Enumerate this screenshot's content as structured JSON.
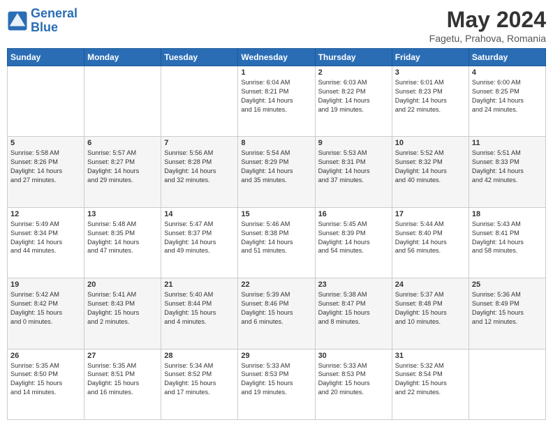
{
  "logo": {
    "line1": "General",
    "line2": "Blue"
  },
  "title": "May 2024",
  "subtitle": "Fagetu, Prahova, Romania",
  "weekdays": [
    "Sunday",
    "Monday",
    "Tuesday",
    "Wednesday",
    "Thursday",
    "Friday",
    "Saturday"
  ],
  "weeks": [
    [
      {
        "day": "",
        "info": ""
      },
      {
        "day": "",
        "info": ""
      },
      {
        "day": "",
        "info": ""
      },
      {
        "day": "1",
        "info": "Sunrise: 6:04 AM\nSunset: 8:21 PM\nDaylight: 14 hours\nand 16 minutes."
      },
      {
        "day": "2",
        "info": "Sunrise: 6:03 AM\nSunset: 8:22 PM\nDaylight: 14 hours\nand 19 minutes."
      },
      {
        "day": "3",
        "info": "Sunrise: 6:01 AM\nSunset: 8:23 PM\nDaylight: 14 hours\nand 22 minutes."
      },
      {
        "day": "4",
        "info": "Sunrise: 6:00 AM\nSunset: 8:25 PM\nDaylight: 14 hours\nand 24 minutes."
      }
    ],
    [
      {
        "day": "5",
        "info": "Sunrise: 5:58 AM\nSunset: 8:26 PM\nDaylight: 14 hours\nand 27 minutes."
      },
      {
        "day": "6",
        "info": "Sunrise: 5:57 AM\nSunset: 8:27 PM\nDaylight: 14 hours\nand 29 minutes."
      },
      {
        "day": "7",
        "info": "Sunrise: 5:56 AM\nSunset: 8:28 PM\nDaylight: 14 hours\nand 32 minutes."
      },
      {
        "day": "8",
        "info": "Sunrise: 5:54 AM\nSunset: 8:29 PM\nDaylight: 14 hours\nand 35 minutes."
      },
      {
        "day": "9",
        "info": "Sunrise: 5:53 AM\nSunset: 8:31 PM\nDaylight: 14 hours\nand 37 minutes."
      },
      {
        "day": "10",
        "info": "Sunrise: 5:52 AM\nSunset: 8:32 PM\nDaylight: 14 hours\nand 40 minutes."
      },
      {
        "day": "11",
        "info": "Sunrise: 5:51 AM\nSunset: 8:33 PM\nDaylight: 14 hours\nand 42 minutes."
      }
    ],
    [
      {
        "day": "12",
        "info": "Sunrise: 5:49 AM\nSunset: 8:34 PM\nDaylight: 14 hours\nand 44 minutes."
      },
      {
        "day": "13",
        "info": "Sunrise: 5:48 AM\nSunset: 8:35 PM\nDaylight: 14 hours\nand 47 minutes."
      },
      {
        "day": "14",
        "info": "Sunrise: 5:47 AM\nSunset: 8:37 PM\nDaylight: 14 hours\nand 49 minutes."
      },
      {
        "day": "15",
        "info": "Sunrise: 5:46 AM\nSunset: 8:38 PM\nDaylight: 14 hours\nand 51 minutes."
      },
      {
        "day": "16",
        "info": "Sunrise: 5:45 AM\nSunset: 8:39 PM\nDaylight: 14 hours\nand 54 minutes."
      },
      {
        "day": "17",
        "info": "Sunrise: 5:44 AM\nSunset: 8:40 PM\nDaylight: 14 hours\nand 56 minutes."
      },
      {
        "day": "18",
        "info": "Sunrise: 5:43 AM\nSunset: 8:41 PM\nDaylight: 14 hours\nand 58 minutes."
      }
    ],
    [
      {
        "day": "19",
        "info": "Sunrise: 5:42 AM\nSunset: 8:42 PM\nDaylight: 15 hours\nand 0 minutes."
      },
      {
        "day": "20",
        "info": "Sunrise: 5:41 AM\nSunset: 8:43 PM\nDaylight: 15 hours\nand 2 minutes."
      },
      {
        "day": "21",
        "info": "Sunrise: 5:40 AM\nSunset: 8:44 PM\nDaylight: 15 hours\nand 4 minutes."
      },
      {
        "day": "22",
        "info": "Sunrise: 5:39 AM\nSunset: 8:46 PM\nDaylight: 15 hours\nand 6 minutes."
      },
      {
        "day": "23",
        "info": "Sunrise: 5:38 AM\nSunset: 8:47 PM\nDaylight: 15 hours\nand 8 minutes."
      },
      {
        "day": "24",
        "info": "Sunrise: 5:37 AM\nSunset: 8:48 PM\nDaylight: 15 hours\nand 10 minutes."
      },
      {
        "day": "25",
        "info": "Sunrise: 5:36 AM\nSunset: 8:49 PM\nDaylight: 15 hours\nand 12 minutes."
      }
    ],
    [
      {
        "day": "26",
        "info": "Sunrise: 5:35 AM\nSunset: 8:50 PM\nDaylight: 15 hours\nand 14 minutes."
      },
      {
        "day": "27",
        "info": "Sunrise: 5:35 AM\nSunset: 8:51 PM\nDaylight: 15 hours\nand 16 minutes."
      },
      {
        "day": "28",
        "info": "Sunrise: 5:34 AM\nSunset: 8:52 PM\nDaylight: 15 hours\nand 17 minutes."
      },
      {
        "day": "29",
        "info": "Sunrise: 5:33 AM\nSunset: 8:53 PM\nDaylight: 15 hours\nand 19 minutes."
      },
      {
        "day": "30",
        "info": "Sunrise: 5:33 AM\nSunset: 8:53 PM\nDaylight: 15 hours\nand 20 minutes."
      },
      {
        "day": "31",
        "info": "Sunrise: 5:32 AM\nSunset: 8:54 PM\nDaylight: 15 hours\nand 22 minutes."
      },
      {
        "day": "",
        "info": ""
      }
    ]
  ]
}
